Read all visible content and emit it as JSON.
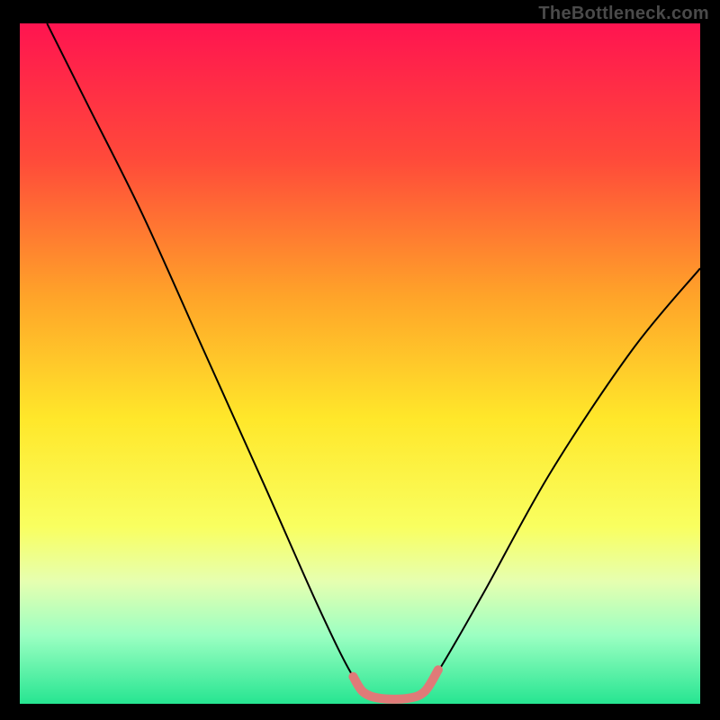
{
  "watermark": "TheBottleneck.com",
  "chart_data": {
    "type": "line",
    "title": "",
    "xlabel": "",
    "ylabel": "",
    "xlim": [
      0,
      100
    ],
    "ylim": [
      0,
      100
    ],
    "background_gradient": {
      "stops": [
        {
          "offset": 0,
          "color": "#ff1450"
        },
        {
          "offset": 20,
          "color": "#ff4a3a"
        },
        {
          "offset": 40,
          "color": "#ffa329"
        },
        {
          "offset": 58,
          "color": "#ffe72a"
        },
        {
          "offset": 74,
          "color": "#f9ff60"
        },
        {
          "offset": 82,
          "color": "#e6ffb0"
        },
        {
          "offset": 90,
          "color": "#9bffc2"
        },
        {
          "offset": 100,
          "color": "#26e591"
        }
      ]
    },
    "series": [
      {
        "name": "bottleneck-curve",
        "color": "#000000",
        "values": [
          {
            "x": 4,
            "y": 100
          },
          {
            "x": 10,
            "y": 88
          },
          {
            "x": 18,
            "y": 72
          },
          {
            "x": 27,
            "y": 52
          },
          {
            "x": 36,
            "y": 32
          },
          {
            "x": 44,
            "y": 14
          },
          {
            "x": 49,
            "y": 4
          },
          {
            "x": 52,
            "y": 1
          },
          {
            "x": 58,
            "y": 1
          },
          {
            "x": 61,
            "y": 4
          },
          {
            "x": 68,
            "y": 16
          },
          {
            "x": 78,
            "y": 34
          },
          {
            "x": 90,
            "y": 52
          },
          {
            "x": 100,
            "y": 64
          }
        ]
      },
      {
        "name": "optimal-zone-marker",
        "color": "#e07a78",
        "thickness": 10,
        "values": [
          {
            "x": 49,
            "y": 4
          },
          {
            "x": 50.5,
            "y": 1.7
          },
          {
            "x": 53,
            "y": 0.8
          },
          {
            "x": 57,
            "y": 0.8
          },
          {
            "x": 59.5,
            "y": 1.8
          },
          {
            "x": 61.5,
            "y": 5
          }
        ]
      }
    ]
  }
}
